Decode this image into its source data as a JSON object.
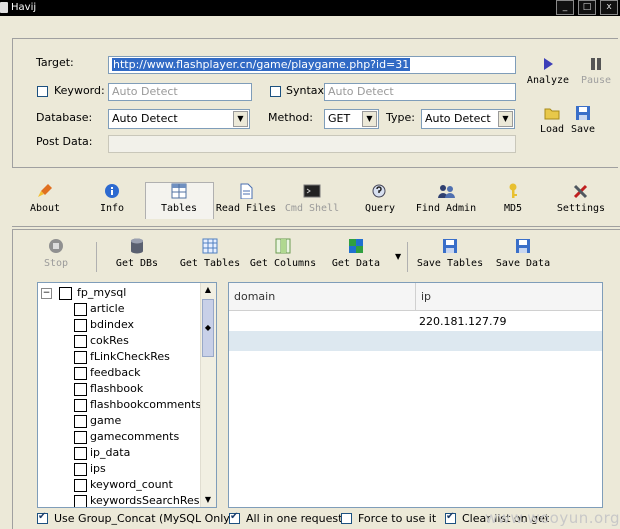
{
  "window": {
    "title": "Havij",
    "min_label": "_",
    "max_label": "□",
    "close_label": "x"
  },
  "top": {
    "target_label": "Target:",
    "target_value": "http://www.flashplayer.cn/game/playgame.php?id=31",
    "keyword_label": "Keyword:",
    "keyword_placeholder": "Auto Detect",
    "syntax_label": "Syntax:",
    "syntax_placeholder": "Auto Detect",
    "database_label": "Database:",
    "database_value": "Auto Detect",
    "method_label": "Method:",
    "method_value": "GET",
    "type_label": "Type:",
    "type_value": "Auto Detect",
    "post_label": "Post Data:",
    "post_value": "",
    "analyze_label": "Analyze",
    "pause_label": "Pause",
    "load_label": "Load",
    "save_label": "Save"
  },
  "tabs": [
    {
      "label": "About",
      "icon": "rocket-icon"
    },
    {
      "label": "Info",
      "icon": "info-icon"
    },
    {
      "label": "Tables",
      "icon": "table-icon"
    },
    {
      "label": "Read Files",
      "icon": "file-icon"
    },
    {
      "label": "Cmd Shell",
      "icon": "terminal-icon"
    },
    {
      "label": "Query",
      "icon": "query-icon"
    },
    {
      "label": "Find Admin",
      "icon": "admin-icon"
    },
    {
      "label": "MD5",
      "icon": "key-icon"
    },
    {
      "label": "Settings",
      "icon": "settings-icon"
    }
  ],
  "toolbar": {
    "stop": "Stop",
    "get_dbs": "Get DBs",
    "get_tables": "Get Tables",
    "get_columns": "Get Columns",
    "get_data": "Get Data",
    "save_tables": "Save Tables",
    "save_data": "Save Data"
  },
  "tree": {
    "root": "fp_mysql",
    "tables": [
      "article",
      "bdindex",
      "cokRes",
      "fLinkCheckRes",
      "feedback",
      "flashbook",
      "flashbookcomments",
      "game",
      "gamecomments",
      "ip_data",
      "ips",
      "keyword_count",
      "keywordsSearchRes"
    ]
  },
  "grid": {
    "columns": [
      "domain",
      "ip"
    ],
    "rows": [
      [
        "",
        "220.181.127.79"
      ]
    ]
  },
  "bottom": {
    "group_concat": "Use Group_Concat (MySQL Only)",
    "all_in_one": "All in one request.",
    "force": "Force to use it",
    "clear": "Clear list on get"
  },
  "watermark": "www.wooyun.org"
}
